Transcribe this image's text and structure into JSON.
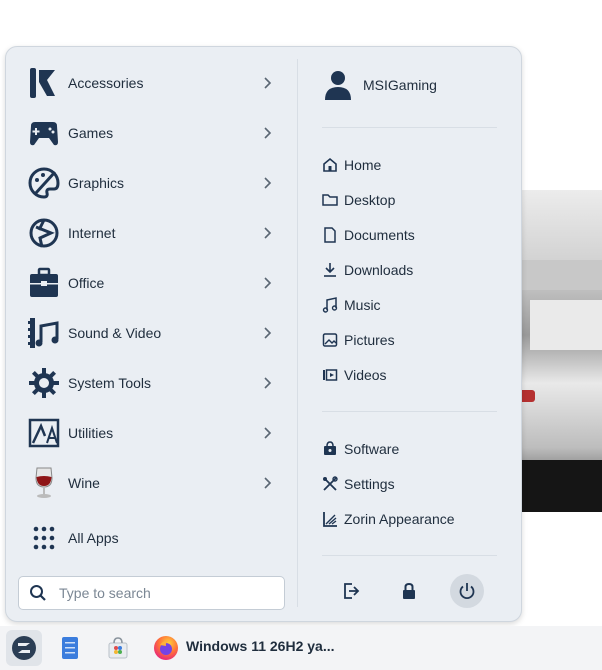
{
  "categories": [
    {
      "label": "Accessories",
      "icon": "accessories-icon"
    },
    {
      "label": "Games",
      "icon": "gamepad-icon"
    },
    {
      "label": "Graphics",
      "icon": "palette-icon"
    },
    {
      "label": "Internet",
      "icon": "globe-icon"
    },
    {
      "label": "Office",
      "icon": "briefcase-icon"
    },
    {
      "label": "Sound & Video",
      "icon": "film-music-icon"
    },
    {
      "label": "System Tools",
      "icon": "gear-icon"
    },
    {
      "label": "Utilities",
      "icon": "utilities-icon"
    },
    {
      "label": "Wine",
      "icon": "wine-glass-icon"
    }
  ],
  "all_apps": {
    "label": "All Apps"
  },
  "user": {
    "name": "MSIGaming"
  },
  "places": [
    {
      "label": "Home",
      "icon": "home-icon"
    },
    {
      "label": "Desktop",
      "icon": "folder-icon"
    },
    {
      "label": "Documents",
      "icon": "document-icon"
    },
    {
      "label": "Downloads",
      "icon": "download-icon"
    },
    {
      "label": "Music",
      "icon": "music-icon"
    },
    {
      "label": "Pictures",
      "icon": "picture-icon"
    },
    {
      "label": "Videos",
      "icon": "video-icon"
    }
  ],
  "system": [
    {
      "label": "Software",
      "icon": "software-icon"
    },
    {
      "label": "Settings",
      "icon": "settings-icon"
    },
    {
      "label": "Zorin Appearance",
      "icon": "appearance-icon"
    }
  ],
  "search": {
    "placeholder": "Type to search"
  },
  "taskbar": {
    "window_title": "Windows 11 26H2 ya..."
  },
  "colors": {
    "icon": "#1f3552",
    "menu_bg": "#eaeef3",
    "accent_blue": "#3b7ddd"
  }
}
